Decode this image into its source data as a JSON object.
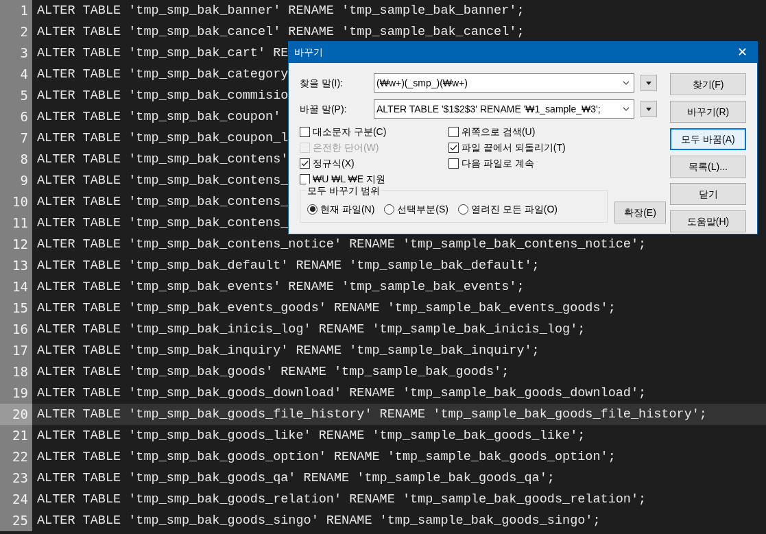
{
  "editor": {
    "lines": [
      {
        "number": "1",
        "text": "ALTER TABLE 'tmp_smp_bak_banner' RENAME 'tmp_sample_bak_banner';",
        "current": false
      },
      {
        "number": "2",
        "text": "ALTER TABLE 'tmp_smp_bak_cancel' RENAME 'tmp_sample_bak_cancel';",
        "current": false
      },
      {
        "number": "3",
        "text": "ALTER TABLE 'tmp_smp_bak_cart' RE",
        "current": false
      },
      {
        "number": "4",
        "text": "ALTER TABLE 'tmp_smp_bak_category",
        "current": false
      },
      {
        "number": "5",
        "text": "ALTER TABLE 'tmp_smp_bak_commisio",
        "current": false
      },
      {
        "number": "6",
        "text": "ALTER TABLE 'tmp_smp_bak_coupon'",
        "current": false
      },
      {
        "number": "7",
        "text": "ALTER TABLE 'tmp_smp_bak_coupon_l",
        "current": false
      },
      {
        "number": "8",
        "text": "ALTER TABLE 'tmp_smp_bak_contens'",
        "current": false
      },
      {
        "number": "9",
        "text": "ALTER TABLE 'tmp_smp_bak_contens_",
        "current": false
      },
      {
        "number": "10",
        "text": "ALTER TABLE 'tmp_smp_bak_contens_",
        "current": false
      },
      {
        "number": "11",
        "text": "ALTER TABLE 'tmp_smp_bak_contens_",
        "current": false
      },
      {
        "number": "12",
        "text": "ALTER TABLE 'tmp_smp_bak_contens_notice' RENAME 'tmp_sample_bak_contens_notice';",
        "current": false
      },
      {
        "number": "13",
        "text": "ALTER TABLE 'tmp_smp_bak_default' RENAME 'tmp_sample_bak_default';",
        "current": false
      },
      {
        "number": "14",
        "text": "ALTER TABLE 'tmp_smp_bak_events' RENAME 'tmp_sample_bak_events';",
        "current": false
      },
      {
        "number": "15",
        "text": "ALTER TABLE 'tmp_smp_bak_events_goods' RENAME 'tmp_sample_bak_events_goods';",
        "current": false
      },
      {
        "number": "16",
        "text": "ALTER TABLE 'tmp_smp_bak_inicis_log' RENAME 'tmp_sample_bak_inicis_log';",
        "current": false
      },
      {
        "number": "17",
        "text": "ALTER TABLE 'tmp_smp_bak_inquiry' RENAME 'tmp_sample_bak_inquiry';",
        "current": false
      },
      {
        "number": "18",
        "text": "ALTER TABLE 'tmp_smp_bak_goods' RENAME 'tmp_sample_bak_goods';",
        "current": false
      },
      {
        "number": "19",
        "text": "ALTER TABLE 'tmp_smp_bak_goods_download' RENAME 'tmp_sample_bak_goods_download';",
        "current": false
      },
      {
        "number": "20",
        "text": "ALTER TABLE 'tmp_smp_bak_goods_file_history' RENAME 'tmp_sample_bak_goods_file_history';",
        "current": true
      },
      {
        "number": "21",
        "text": "ALTER TABLE 'tmp_smp_bak_goods_like' RENAME 'tmp_sample_bak_goods_like';",
        "current": false
      },
      {
        "number": "22",
        "text": "ALTER TABLE 'tmp_smp_bak_goods_option' RENAME 'tmp_sample_bak_goods_option';",
        "current": false
      },
      {
        "number": "23",
        "text": "ALTER TABLE 'tmp_smp_bak_goods_qa' RENAME 'tmp_sample_bak_goods_qa';",
        "current": false
      },
      {
        "number": "24",
        "text": "ALTER TABLE 'tmp_smp_bak_goods_relation' RENAME 'tmp_sample_bak_goods_relation';",
        "current": false
      },
      {
        "number": "25",
        "text": "ALTER TABLE 'tmp_smp_bak_goods_singo' RENAME 'tmp_sample_bak_goods_singo';",
        "current": false
      }
    ]
  },
  "dialog": {
    "title": "바꾸기",
    "close": "✕",
    "fields": [
      {
        "label": "찾을 말(I):",
        "value": "(₩w+)(_smp_)(₩w+)"
      },
      {
        "label": "바꿀 말(P):",
        "value": "ALTER TABLE '$1$2$3' RENAME '₩1_sample_₩3';"
      }
    ],
    "options": [
      {
        "label": "대소문자 구분(C)",
        "checked": false,
        "disabled": false
      },
      {
        "label": "위쪽으로 검색(U)",
        "checked": false,
        "disabled": false
      },
      {
        "label": "온전한 단어(W)",
        "checked": false,
        "disabled": true
      },
      {
        "label": "파일 끝에서 되돌리기(T)",
        "checked": true,
        "disabled": false
      },
      {
        "label": "정규식(X)",
        "checked": true,
        "disabled": false
      },
      {
        "label": "다음 파일로 계속",
        "checked": false,
        "disabled": false
      },
      {
        "label": "₩U ₩L ₩E 지원",
        "checked": false,
        "disabled": false
      }
    ],
    "scope": {
      "title": "모두 바꾸기 범위",
      "choices": [
        {
          "label": "현재 파일(N)",
          "selected": true
        },
        {
          "label": "선택부분(S)",
          "selected": false
        },
        {
          "label": "열려진 모든 파일(O)",
          "selected": false
        }
      ]
    },
    "expand_button": "확장(E)",
    "buttons": [
      {
        "label": "찾기(F)",
        "default": false
      },
      {
        "label": "바꾸기(R)",
        "default": false
      },
      {
        "label": "모두 바꿈(A)",
        "default": true
      },
      {
        "label": "목록(L)...",
        "default": false
      },
      {
        "label": "닫기",
        "default": false
      },
      {
        "label": "도움말(H)",
        "default": false
      }
    ]
  }
}
